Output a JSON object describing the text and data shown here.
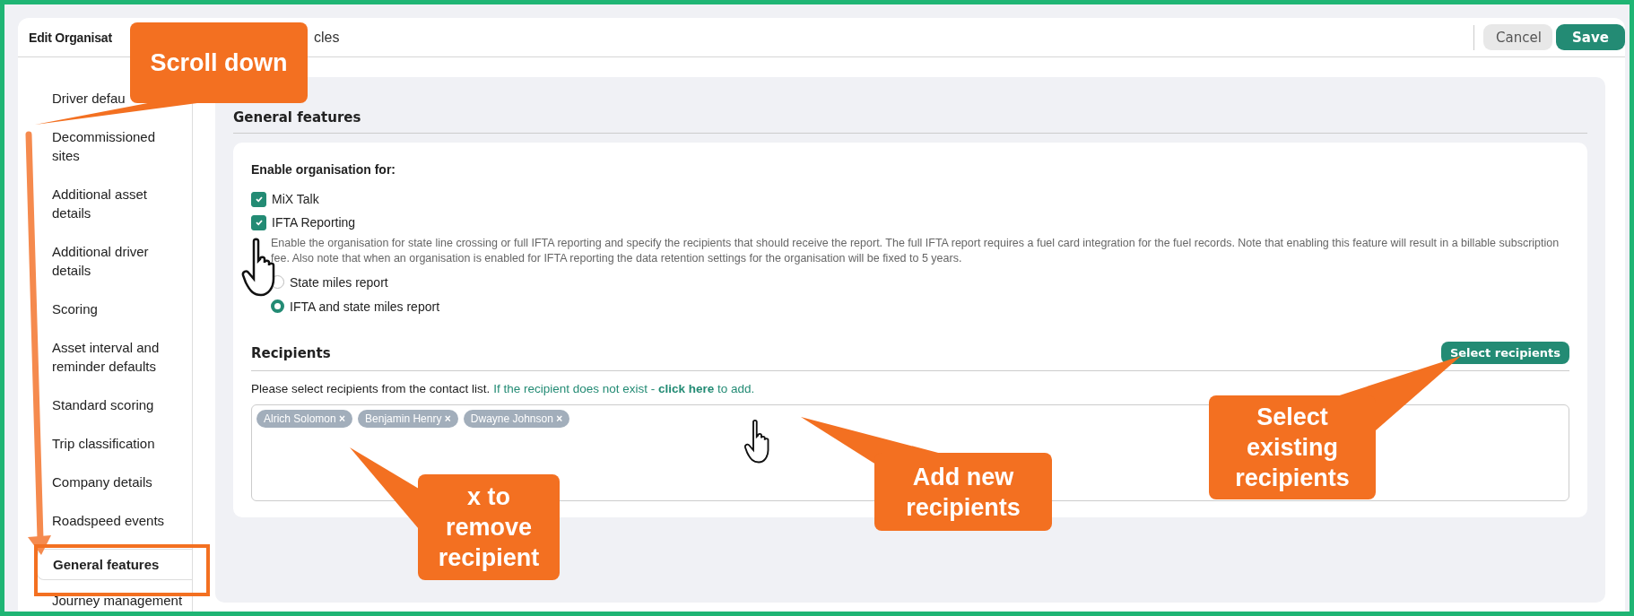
{
  "header": {
    "title": "Edit Organisat",
    "tab_fragment": "cles",
    "buttons": [
      {
        "label": "Cancel",
        "kind": "secondary"
      },
      {
        "label": "Save",
        "kind": "primary"
      }
    ]
  },
  "sidebar": {
    "items": [
      {
        "label": "Driver defau",
        "selected": false
      },
      {
        "label": "Decommissioned sites",
        "selected": false
      },
      {
        "label": "Additional asset details",
        "selected": false
      },
      {
        "label": "Additional driver details",
        "selected": false
      },
      {
        "label": "Scoring",
        "selected": false
      },
      {
        "label": "Asset interval and reminder defaults",
        "selected": false
      },
      {
        "label": "Standard scoring",
        "selected": false
      },
      {
        "label": "Trip classification",
        "selected": false
      },
      {
        "label": "Company details",
        "selected": false
      },
      {
        "label": "Roadspeed events",
        "selected": false
      },
      {
        "label": "General features",
        "selected": true
      },
      {
        "label": "Journey management",
        "selected": false
      }
    ]
  },
  "section": {
    "title": "General features",
    "enable_label": "Enable organisation for:",
    "features": [
      {
        "label": "MiX Talk",
        "checked": true
      },
      {
        "label": "IFTA Reporting",
        "checked": true
      }
    ],
    "description": "Enable the organisation for state line crossing or full IFTA reporting and specify the recipients that should receive the report. The full IFTA report requires a fuel card integration for the fuel records. Note that enabling this feature will result in a billable subscription fee. Also note that when an organisation is enabled for IFTA reporting the data retention settings for the organisation will be fixed to 5 years.",
    "report_options": [
      {
        "label": "State miles report",
        "selected": false
      },
      {
        "label": "IFTA and state miles report",
        "selected": true
      }
    ],
    "recipients": {
      "title": "Recipients",
      "select_button": "Select recipients",
      "instructions": "Please select recipients from the contact list.",
      "add_link": "If the recipient does not exist - **click here** to add.",
      "tags": [
        {
          "name": "Alrich Solomon",
          "remove": "×"
        },
        {
          "name": "Benjamin Henry",
          "remove": "×"
        },
        {
          "name": "Dwayne Johnson",
          "remove": "×"
        }
      ]
    }
  },
  "annotations": [
    {
      "text": "Scroll down"
    },
    {
      "text": "x to remove recipient"
    },
    {
      "text": "Add new recipients"
    },
    {
      "text": "Select existing recipients"
    }
  ]
}
